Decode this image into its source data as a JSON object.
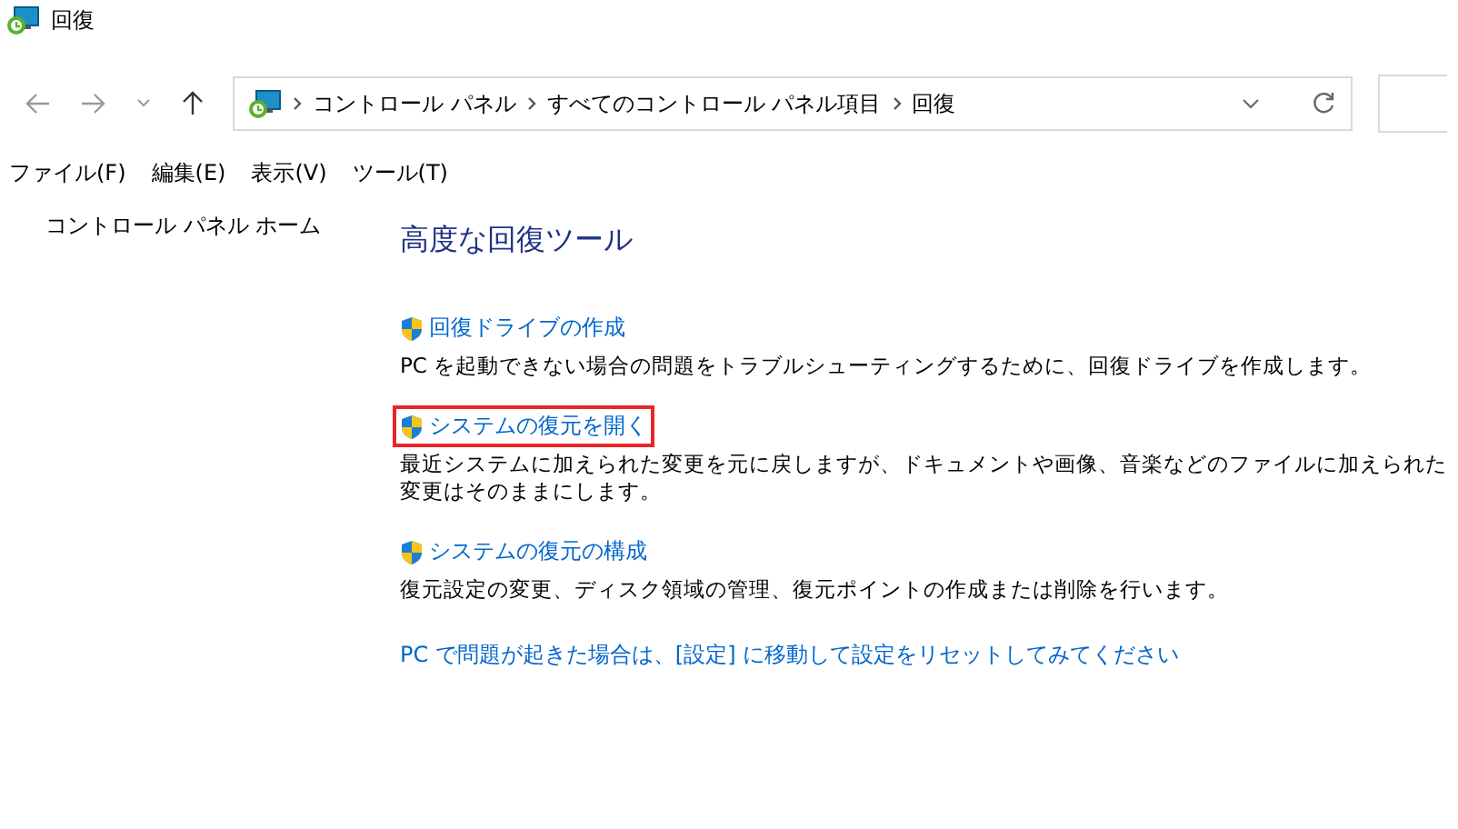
{
  "window": {
    "title": "回復"
  },
  "address_bar": {
    "breadcrumbs": [
      "コントロール パネル",
      "すべてのコントロール パネル項目",
      "回復"
    ]
  },
  "menu_bar": [
    "ファイル(F)",
    "編集(E)",
    "表示(V)",
    "ツール(T)"
  ],
  "sidebar": {
    "items": [
      "コントロール パネル ホーム"
    ]
  },
  "main": {
    "heading": "高度な回復ツール",
    "tasks": [
      {
        "link": "回復ドライブの作成",
        "description": "PC を起動できない場合の問題をトラブルシューティングするために、回復ドライブを作成します。",
        "highlighted": false
      },
      {
        "link": "システムの復元を開く",
        "description": "最近システムに加えられた変更を元に戻しますが、ドキュメントや画像、音楽などのファイルに加えられた変更はそのままにします。",
        "highlighted": true
      },
      {
        "link": "システムの復元の構成",
        "description": "復元設定の変更、ディスク領域の管理、復元ポイントの作成または削除を行います。",
        "highlighted": false
      }
    ],
    "footer_link": "PC で問題が起きた場合は、[設定] に移動して設定をリセットしてみてください"
  }
}
